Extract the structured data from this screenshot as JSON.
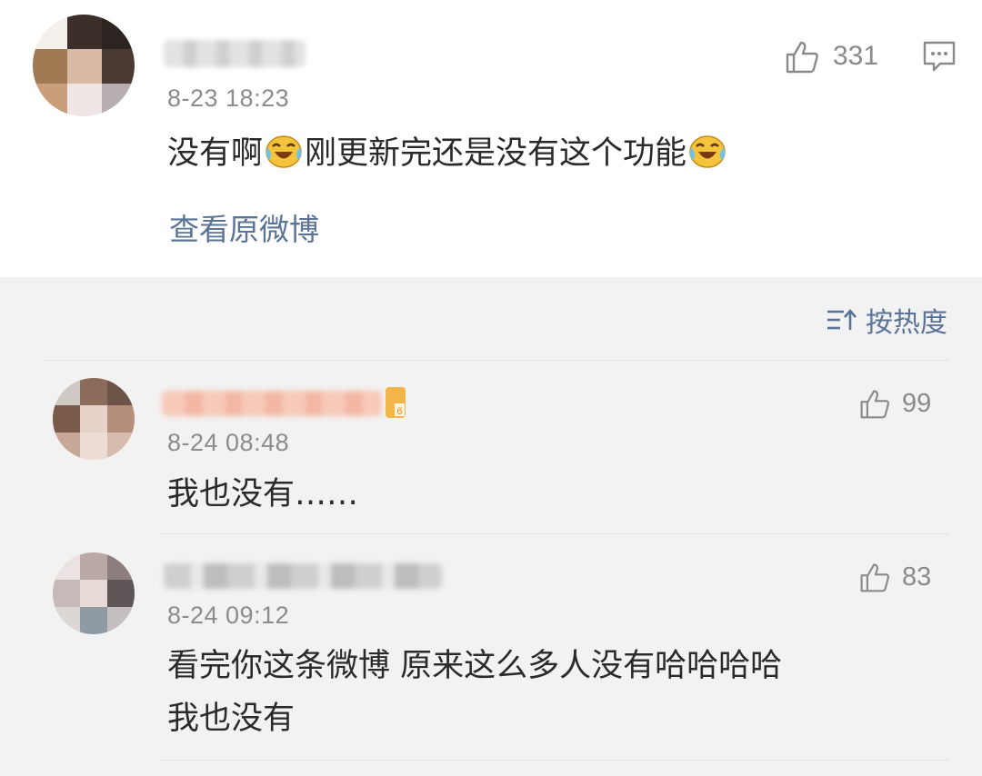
{
  "main_post": {
    "time": "8-23 18:23",
    "like_count": "331",
    "text_part1": "没有啊",
    "text_part2": "刚更新完还是没有这个功能",
    "view_original_label": "查看原微博"
  },
  "sort": {
    "label": "按热度"
  },
  "comments": [
    {
      "time": "8-24 08:48",
      "like_count": "99",
      "text": "我也没有……"
    },
    {
      "time": "8-24 09:12",
      "like_count": "83",
      "text_line1": "看完你这条微博 原来这么多人没有哈哈哈哈",
      "text_line2": "我也没有"
    }
  ],
  "icons": {
    "like": "thumbs-up-icon",
    "comment": "comment-icon",
    "emoji": "laughing-crying-emoji-icon",
    "sort": "sort-icon",
    "level_badge": "level-badge-icon"
  },
  "colors": {
    "link": "#5a7399",
    "text": "#2a2a2a",
    "meta": "#8c8c8c",
    "background": "#f2f2f2"
  }
}
